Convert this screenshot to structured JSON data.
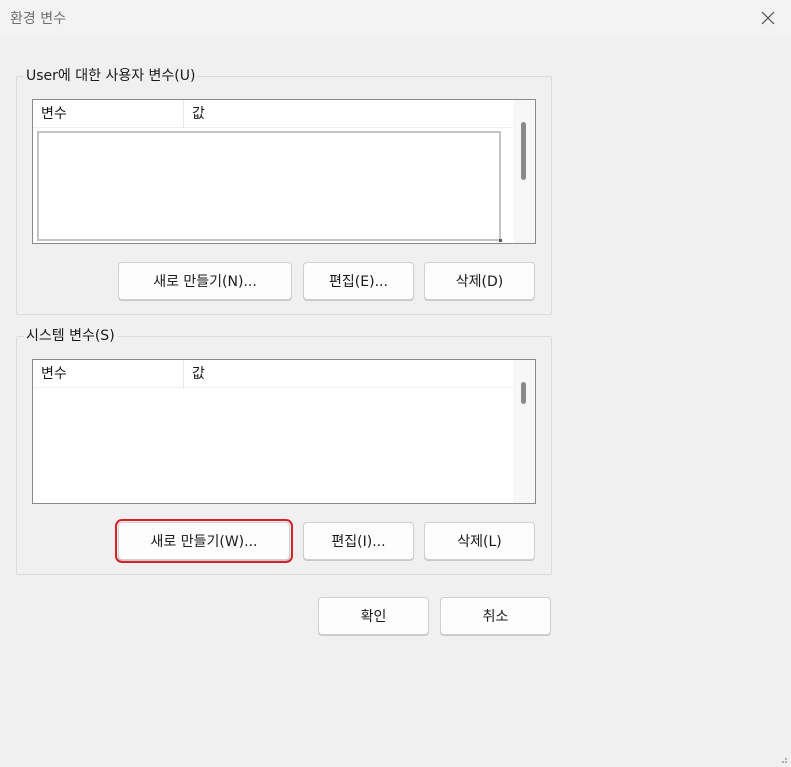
{
  "window": {
    "title": "환경 변수"
  },
  "user_group": {
    "label": "User에 대한 사용자 변수(U)",
    "columns": [
      "변수",
      "값"
    ],
    "buttons": {
      "new": "새로 만들기(N)...",
      "edit": "편집(E)...",
      "delete": "삭제(D)"
    }
  },
  "system_group": {
    "label": "시스템 변수(S)",
    "columns": [
      "변수",
      "값"
    ],
    "buttons": {
      "new": "새로 만들기(W)...",
      "edit": "편집(I)...",
      "delete": "삭제(L)"
    }
  },
  "footer": {
    "ok": "확인",
    "cancel": "취소"
  },
  "colors": {
    "highlight": "#d9202a"
  },
  "icons": {
    "close": "close-icon",
    "resize": "resize-grip-icon"
  }
}
